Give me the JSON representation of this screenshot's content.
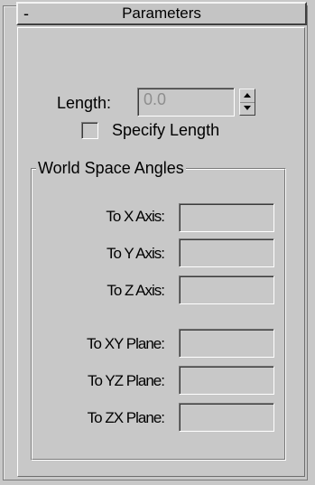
{
  "rollout": {
    "collapse_symbol": "-",
    "title": "Parameters"
  },
  "length": {
    "label": "Length:",
    "value": "0.0"
  },
  "specify_length": {
    "label": "Specify Length",
    "checked": false
  },
  "world_space_angles": {
    "title": "World Space Angles",
    "fields": [
      {
        "label": "To X Axis:",
        "value": ""
      },
      {
        "label": "To Y Axis:",
        "value": ""
      },
      {
        "label": "To Z Axis:",
        "value": ""
      },
      {
        "label": "To XY Plane:",
        "value": ""
      },
      {
        "label": "To YZ Plane:",
        "value": ""
      },
      {
        "label": "To ZX Plane:",
        "value": ""
      }
    ]
  },
  "colors": {
    "panel_background": "#c8c8c8",
    "disabled_text": "#8e8e8e"
  }
}
